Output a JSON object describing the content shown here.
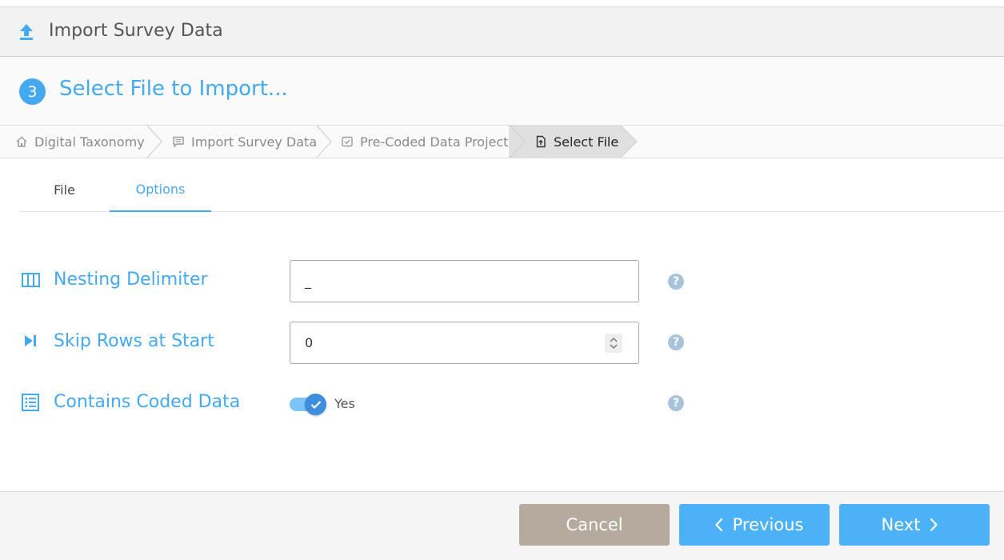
{
  "window": {
    "title": "Import Survey Data",
    "icon": "upload-icon"
  },
  "step": {
    "number": "3",
    "title": "Select File to Import..."
  },
  "breadcrumb": [
    {
      "label": "Digital Taxonomy",
      "icon": "home-icon"
    },
    {
      "label": "Import Survey Data",
      "icon": "message-icon"
    },
    {
      "label": "Pre-Coded Data Project",
      "icon": "checkbox-icon"
    },
    {
      "label": "Select File",
      "icon": "file-upload-icon"
    }
  ],
  "tabs": [
    {
      "label": "File"
    },
    {
      "label": "Options"
    }
  ],
  "active_tab": "Options",
  "options": {
    "nesting_delimiter": {
      "label": "Nesting Delimiter",
      "value": "_",
      "icon": "columns-icon",
      "help": "?"
    },
    "skip_rows": {
      "label": "Skip Rows at Start",
      "value": "0",
      "icon": "skip-next-icon",
      "help": "?"
    },
    "coded_data": {
      "label": "Contains Coded Data",
      "state": "Yes",
      "icon": "list-icon",
      "help": "?"
    }
  },
  "footer": {
    "cancel": "Cancel",
    "previous": "Previous",
    "next": "Next"
  },
  "colors": {
    "accent": "#45a9f0",
    "button_primary": "#4db1f8",
    "button_cancel": "#b6aa9e",
    "help": "#a9c3da"
  }
}
